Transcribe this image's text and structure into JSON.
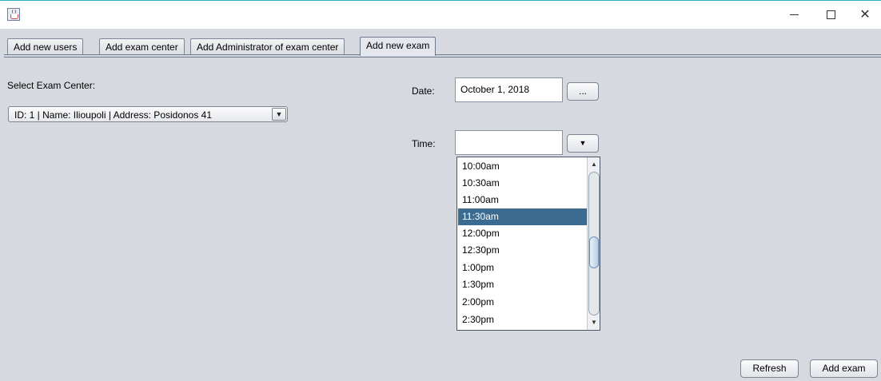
{
  "window": {
    "minimize_glyph": "",
    "maximize_glyph": "",
    "close_glyph": "✕"
  },
  "tabs": [
    {
      "label": "Add new users"
    },
    {
      "label": "Add exam center"
    },
    {
      "label": "Add Administrator of exam center"
    },
    {
      "label": "Add new exam"
    }
  ],
  "selected_tab": "Add new exam",
  "exam_center": {
    "label": "Select Exam Center:",
    "selected": "ID: 1 | Name: Ilioupoli | Address: Posidonos 41"
  },
  "date": {
    "label": "Date:",
    "value": "October 1, 2018",
    "picker_button": "..."
  },
  "time": {
    "label": "Time:",
    "value": "",
    "options": [
      "10:00am",
      "10:30am",
      "11:00am",
      "11:30am",
      "12:00pm",
      "12:30pm",
      "1:00pm",
      "1:30pm",
      "2:00pm",
      "2:30pm"
    ],
    "highlighted": "11:30am"
  },
  "actions": {
    "refresh": "Refresh",
    "add_exam": "Add exam"
  },
  "icons": {
    "app": "java-app-icon",
    "dropdown": "chevron-down-icon",
    "scroll_up": "scroll-up-arrow-icon",
    "scroll_down": "scroll-down-arrow-icon"
  },
  "colors": {
    "selection": "#3b6b91",
    "background": "#d6d9df"
  }
}
